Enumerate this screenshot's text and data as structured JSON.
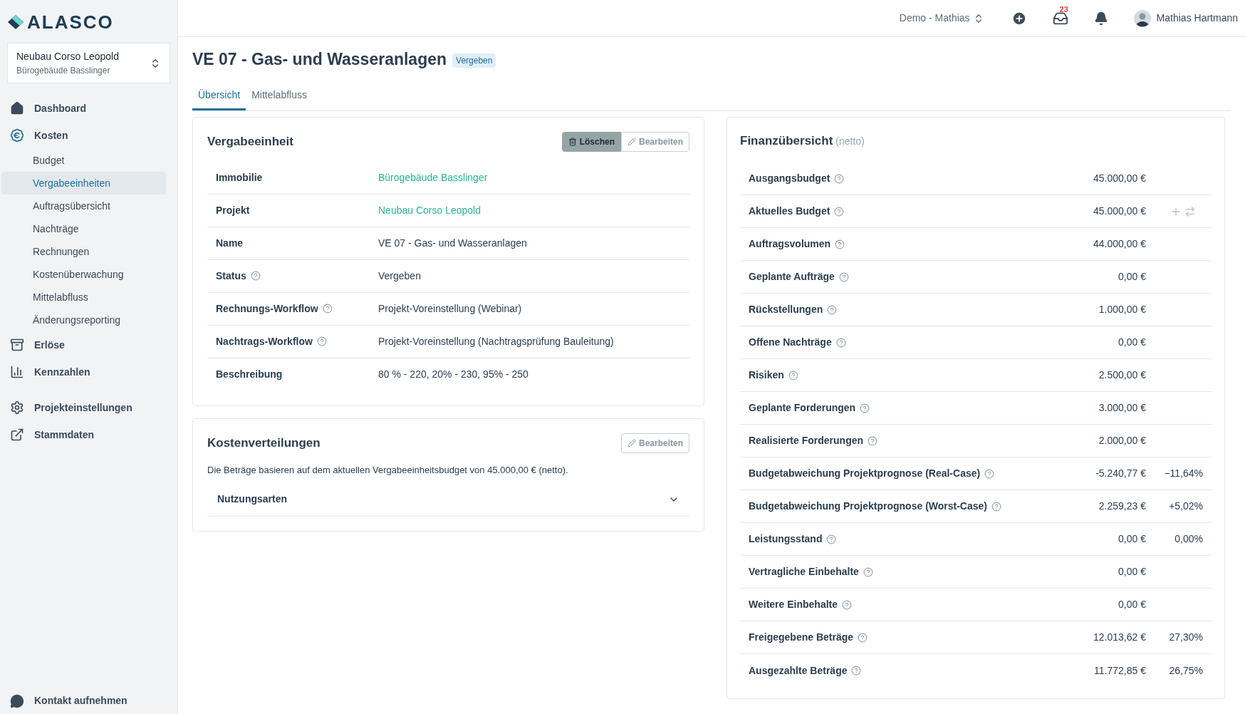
{
  "logo": "ALASCO",
  "project_switcher": {
    "title": "Neubau Corso Leopold",
    "subtitle": "Bürogebäude Basslinger"
  },
  "sidebar": {
    "items": [
      {
        "label": "Dashboard",
        "selected": false
      },
      {
        "label": "Kosten",
        "selected": false,
        "children": [
          {
            "label": "Budget",
            "selected": false
          },
          {
            "label": "Vergabeeinheiten",
            "selected": true
          },
          {
            "label": "Auftragsübersicht",
            "selected": false
          },
          {
            "label": "Nachträge",
            "selected": false
          },
          {
            "label": "Rechnungen",
            "selected": false
          },
          {
            "label": "Kostenüberwachung",
            "selected": false
          },
          {
            "label": "Mittelabfluss",
            "selected": false
          },
          {
            "label": "Änderungsreporting",
            "selected": false
          }
        ]
      },
      {
        "label": "Erlöse",
        "selected": false
      },
      {
        "label": "Kennzahlen",
        "selected": false
      },
      {
        "label": "Projekteinstellungen",
        "selected": false
      },
      {
        "label": "Stammdaten",
        "selected": false
      }
    ],
    "footer": "Kontakt aufnehmen"
  },
  "header": {
    "workspace": "Demo - Mathias",
    "inbox_count": "23",
    "user": "Mathias Hartmann"
  },
  "page": {
    "title": "VE 07 - Gas- und Wasseranlagen",
    "status_badge": "Vergeben"
  },
  "tabs": [
    {
      "label": "Übersicht",
      "selected": true
    },
    {
      "label": "Mittelabfluss",
      "selected": false
    }
  ],
  "vergabeeinheit": {
    "title": "Vergabeeinheit",
    "delete_button": "Löschen",
    "edit_button": "Bearbeiten",
    "rows": [
      {
        "label": "Immobilie",
        "help": false,
        "kind": "link",
        "value": "Bürogebäude Basslinger"
      },
      {
        "label": "Projekt",
        "help": false,
        "kind": "link",
        "value": "Neubau Corso Leopold"
      },
      {
        "label": "Name",
        "help": false,
        "kind": "text",
        "value": "VE 07 - Gas- und Wasseranlagen"
      },
      {
        "label": "Status",
        "help": true,
        "kind": "text",
        "value": "Vergeben"
      },
      {
        "label": "Rechnungs-Workflow",
        "help": true,
        "kind": "text",
        "value": "Projekt-Voreinstellung (Webinar)"
      },
      {
        "label": "Nachtrags-Workflow",
        "help": true,
        "kind": "text",
        "value": "Projekt-Voreinstellung (Nachtragsprüfung Bauleitung)"
      },
      {
        "label": "Beschreibung",
        "help": false,
        "kind": "text",
        "value": "80 % - 220, 20% - 230, 95% - 250"
      }
    ]
  },
  "kostenverteilungen": {
    "title": "Kostenverteilungen",
    "edit_button": "Bearbeiten",
    "note": "Die Beträge basieren auf dem aktuellen Vergabeeinheitsbudget von 45.000,00 € (netto).",
    "accordion": {
      "label": "Nutzungsarten",
      "expanded": false
    }
  },
  "finanzuebersicht": {
    "title": "Finanzübersicht",
    "subtitle": "(netto)",
    "rows": [
      {
        "label": "Ausgangsbudget",
        "value": "45.000,00 €",
        "actions": false
      },
      {
        "label": "Aktuelles Budget",
        "value": "45.000,00 €",
        "actions": true
      },
      {
        "label": "Auftragsvolumen",
        "value": "44.000,00 €",
        "actions": false
      },
      {
        "label": "Geplante Aufträge",
        "value": "0,00 €",
        "actions": false
      },
      {
        "label": "Rückstellungen",
        "value": "1.000,00 €",
        "actions": false
      },
      {
        "label": "Offene Nachträge",
        "value": "0,00 €",
        "actions": false
      },
      {
        "label": "Risiken",
        "value": "2.500,00 €",
        "actions": false
      },
      {
        "label": "Geplante Forderungen",
        "value": "3.000,00 €",
        "actions": false
      },
      {
        "label": "Realisierte Forderungen",
        "value": "2.000,00 €",
        "actions": false
      },
      {
        "label": "Budgetabweichung Projektprognose (Real-Case)",
        "value": "-5.240,77 €",
        "percent": "−11,64%",
        "actions": false
      },
      {
        "label": "Budgetabweichung Projektprognose (Worst-Case)",
        "value": "2.259,23 €",
        "percent": "+5,02%",
        "actions": false
      },
      {
        "label": "Leistungsstand",
        "value": "0,00 €",
        "percent": "0,00%",
        "actions": false
      },
      {
        "label": "Vertragliche Einbehalte",
        "value": "0,00 €",
        "actions": false
      },
      {
        "label": "Weitere Einbehalte",
        "value": "0,00 €",
        "actions": false
      },
      {
        "label": "Freigegebene Beträge",
        "value": "12.013,62 €",
        "percent": "27,30%",
        "actions": false
      },
      {
        "label": "Ausgezahlte Beträge",
        "value": "11.772,85 €",
        "percent": "26,75%",
        "actions": false
      }
    ]
  }
}
